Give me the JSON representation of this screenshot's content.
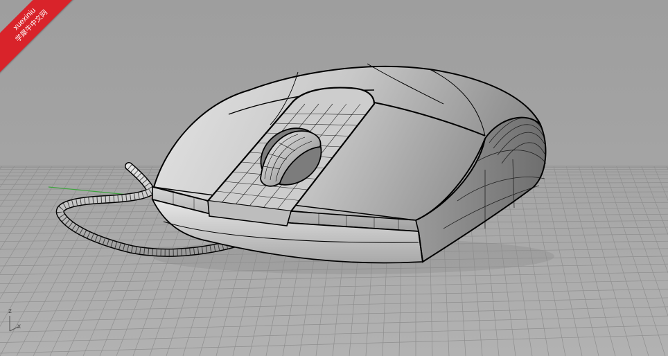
{
  "watermark": {
    "site": "xuexiniu",
    "name": "学犀牛中文网"
  },
  "viewport": {
    "axis_z": "z",
    "axis_x": "x"
  },
  "colors": {
    "background": "#a4a4a4",
    "grid": "#8e8e8e",
    "x_axis": "#b04040",
    "y_axis": "#3ca33c",
    "watermark": "#d9232a",
    "wire": "#000000"
  },
  "model": {
    "object": "computer-mouse",
    "display_mode": "shaded-wireframe"
  }
}
